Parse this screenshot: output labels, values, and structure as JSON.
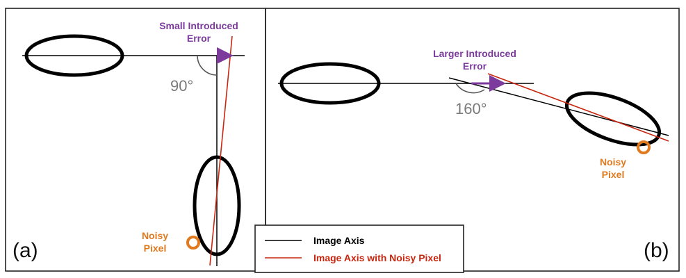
{
  "colors": {
    "image_axis": "#000000",
    "noisy_axis": "#c8260e",
    "error_arrow": "#7b3a9c",
    "noisy_pixel": "#e07a1f",
    "angle_text": "#7a7a7a",
    "frame": "#222222"
  },
  "panel_a": {
    "label": "(a)",
    "error_label_line1": "Small Introduced",
    "error_label_line2": "Error",
    "angle": "90°",
    "noisy_label_line1": "Noisy",
    "noisy_label_line2": "Pixel"
  },
  "panel_b": {
    "label": "(b)",
    "error_label_line1": "Larger Introduced",
    "error_label_line2": "Error",
    "angle": "160°",
    "noisy_label_line1": "Noisy",
    "noisy_label_line2": "Pixel"
  },
  "legend": {
    "image_axis": "Image Axis",
    "noisy_axis": "Image Axis with Noisy Pixel"
  }
}
